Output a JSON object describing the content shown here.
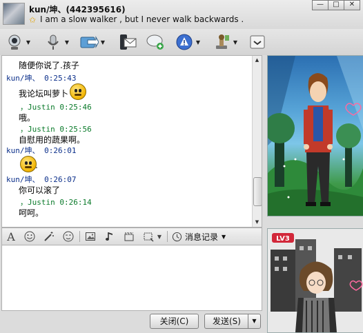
{
  "titlebar": {
    "name": "kun/坤、(442395616)",
    "signature": "I am a slow walker , but I never walk backwards  .",
    "minimize": "—",
    "maximize": "□",
    "close": "✕"
  },
  "toolbar": {
    "items": [
      "webcam-icon",
      "microphone-icon",
      "transfer-file-icon",
      "send-email-icon",
      "group-chat-icon",
      "alert-icon",
      "stamp-icon",
      "more-icon"
    ]
  },
  "messages": [
    {
      "type": "body",
      "text": "随便你说了.孩子"
    },
    {
      "type": "header",
      "color": "blue",
      "text": "kun/坤、   0:25:43"
    },
    {
      "type": "body",
      "text": "我论坛叫萝卜"
    },
    {
      "type": "header",
      "color": "green",
      "text": "，Justin  0:25:46"
    },
    {
      "type": "body",
      "text": "哦。"
    },
    {
      "type": "header",
      "color": "green",
      "text": "，Justin  0:25:56"
    },
    {
      "type": "body",
      "text": "自慰用的蔬果啊。"
    },
    {
      "type": "header",
      "color": "blue",
      "text": "kun/坤、   0:26:01"
    },
    {
      "type": "body",
      "text": "."
    },
    {
      "type": "header",
      "color": "blue",
      "text": "kun/坤、   0:26:07"
    },
    {
      "type": "body",
      "text": "你可以滚了"
    },
    {
      "type": "header",
      "color": "green",
      "text": "，Justin  0:26:14"
    },
    {
      "type": "body",
      "text": "呵呵。"
    }
  ],
  "format_toolbar": {
    "font_glyph": "A",
    "history_label": "消息记录"
  },
  "buttons": {
    "close_label": "关闭(C)",
    "send_label": "发送(S)"
  },
  "badges": {
    "level": "LV3"
  },
  "colors": {
    "accent_blue": "#0b2f8a",
    "accent_green": "#0a7a2a"
  }
}
